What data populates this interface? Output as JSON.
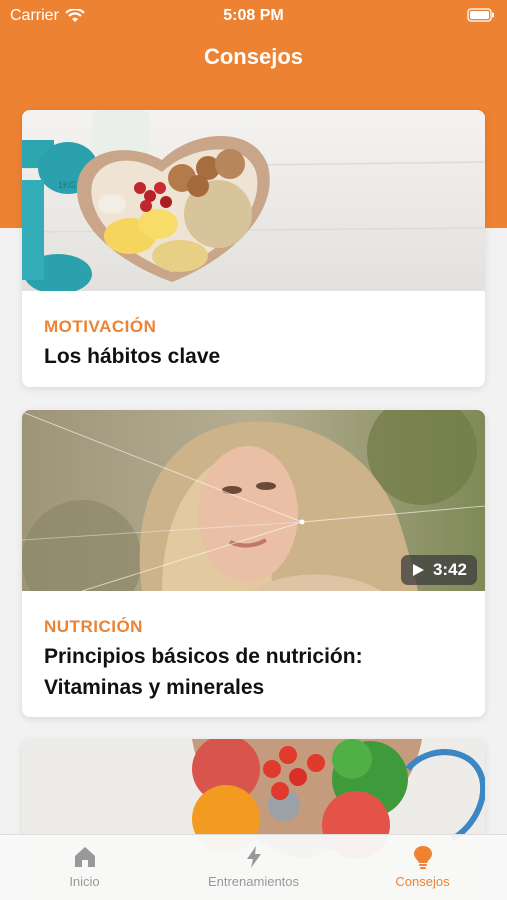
{
  "status_bar": {
    "carrier": "Carrier",
    "time": "5:08 PM"
  },
  "header": {
    "title": "Consejos"
  },
  "cards": [
    {
      "category": "MOTIVACIÓN",
      "title": "Los hábitos clave"
    },
    {
      "category": "NUTRICIÓN",
      "title": "Principios básicos de nutrición: Vitaminas y minerales",
      "duration": "3:42"
    }
  ],
  "tabs": [
    {
      "label": "Inicio",
      "icon": "home-icon"
    },
    {
      "label": "Entrenamientos",
      "icon": "bolt-icon"
    },
    {
      "label": "Consejos",
      "icon": "lightbulb-icon",
      "active": true
    }
  ],
  "colors": {
    "accent": "#ee8233",
    "inactive": "#999999"
  }
}
